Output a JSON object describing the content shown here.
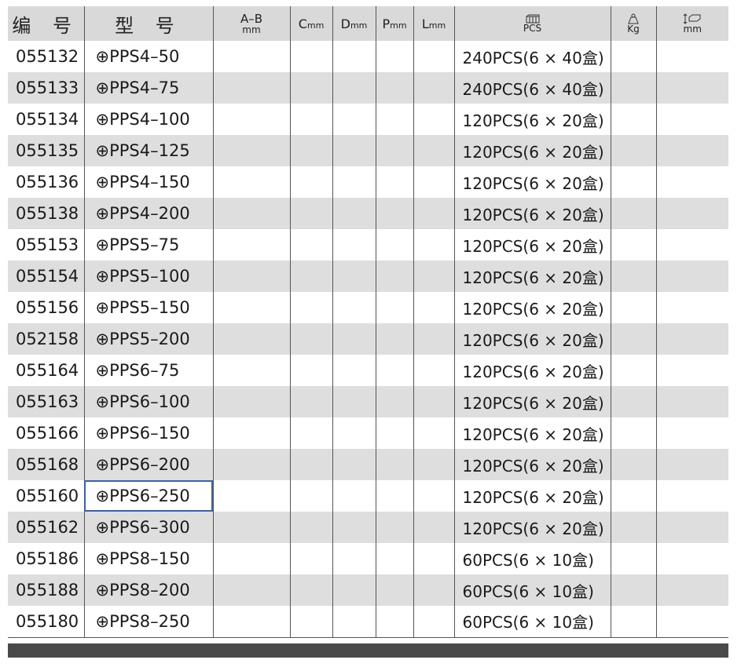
{
  "header": {
    "code": "编 号",
    "model": "型 号",
    "ab": "A–B",
    "ab_unit": "mm",
    "c": "C",
    "d": "D",
    "p": "P",
    "l": "L",
    "unit_mm": "mm",
    "pcs": "PCS",
    "kg": "Kg",
    "size_unit": "mm",
    "pcs_icon": "box-icon",
    "kg_icon": "weight-icon",
    "size_icon": "dimension-icon"
  },
  "rows": [
    {
      "code": "055132",
      "model": "⊕PPS4–50",
      "pack": "240PCS(6 × 40盒)"
    },
    {
      "code": "055133",
      "model": "⊕PPS4–75",
      "pack": "240PCS(6 × 40盒)"
    },
    {
      "code": "055134",
      "model": "⊕PPS4–100",
      "pack": "120PCS(6 × 20盒)"
    },
    {
      "code": "055135",
      "model": "⊕PPS4–125",
      "pack": "120PCS(6 × 20盒)"
    },
    {
      "code": "055136",
      "model": "⊕PPS4–150",
      "pack": "120PCS(6 × 20盒)"
    },
    {
      "code": "055138",
      "model": "⊕PPS4–200",
      "pack": "120PCS(6 × 20盒)"
    },
    {
      "code": "055153",
      "model": "⊕PPS5–75",
      "pack": "120PCS(6 × 20盒)"
    },
    {
      "code": "055154",
      "model": "⊕PPS5–100",
      "pack": "120PCS(6 × 20盒)"
    },
    {
      "code": "055156",
      "model": "⊕PPS5–150",
      "pack": "120PCS(6 × 20盒)"
    },
    {
      "code": "052158",
      "model": "⊕PPS5–200",
      "pack": "120PCS(6 × 20盒)"
    },
    {
      "code": "055164",
      "model": "⊕PPS6–75",
      "pack": "120PCS(6 × 20盒)"
    },
    {
      "code": "055163",
      "model": "⊕PPS6–100",
      "pack": "120PCS(6 × 20盒)"
    },
    {
      "code": "055166",
      "model": "⊕PPS6–150",
      "pack": "120PCS(6 × 20盒)"
    },
    {
      "code": "055168",
      "model": "⊕PPS6–200",
      "pack": "120PCS(6 × 20盒)"
    },
    {
      "code": "055160",
      "model": "⊕PPS6–250",
      "pack": "120PCS(6 × 20盒)",
      "highlight": true
    },
    {
      "code": "055162",
      "model": "⊕PPS6–300",
      "pack": "120PCS(6 × 20盒)"
    },
    {
      "code": "055186",
      "model": "⊕PPS8–150",
      "pack": "60PCS(6 × 10盒)"
    },
    {
      "code": "055188",
      "model": "⊕PPS8–200",
      "pack": "60PCS(6 × 10盒)"
    },
    {
      "code": "055180",
      "model": "⊕PPS8–250",
      "pack": "60PCS(6 × 10盒)"
    }
  ],
  "colors": {
    "header_bg": "#d9d9d9",
    "stripe_bg": "#dedede",
    "highlight_border": "#3a5fb8",
    "footer_bar": "#4a4a4a"
  }
}
